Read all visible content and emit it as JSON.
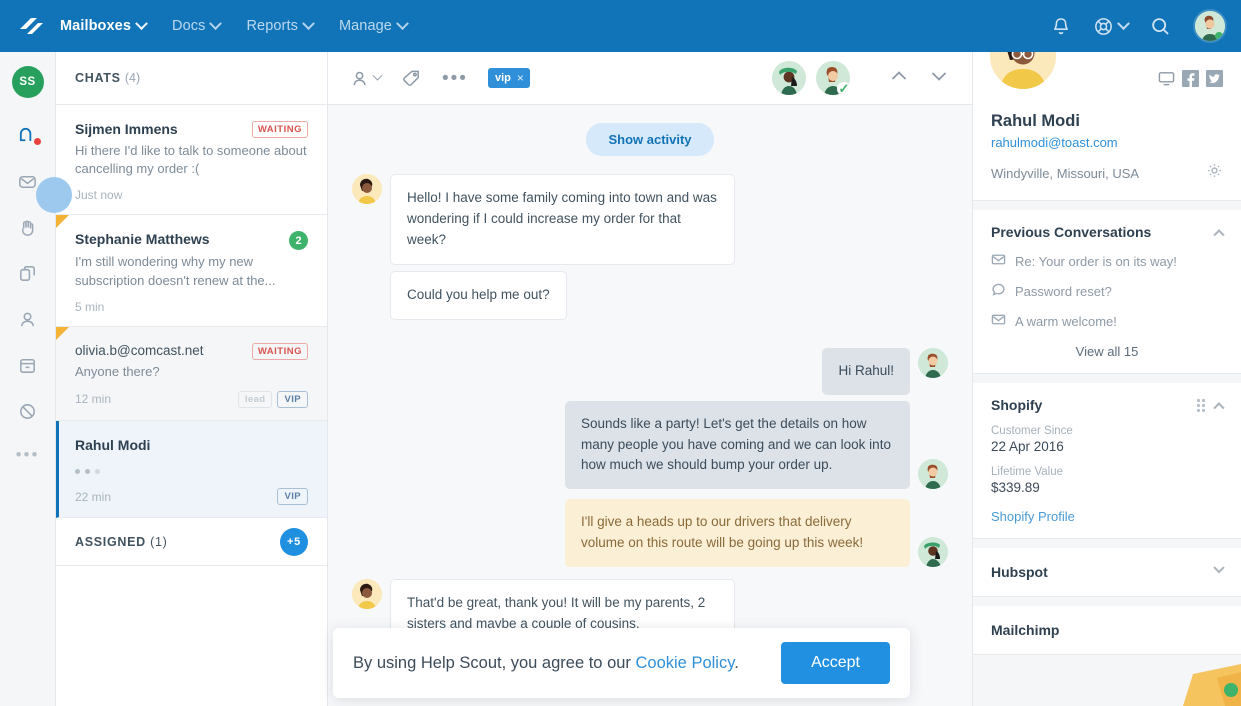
{
  "topnav": {
    "logo": "helpscout-logo-icon",
    "items": [
      {
        "label": "Mailboxes",
        "active": true,
        "caret": true
      },
      {
        "label": "Docs",
        "active": false,
        "caret": true
      },
      {
        "label": "Reports",
        "active": false,
        "caret": true
      },
      {
        "label": "Manage",
        "active": false,
        "caret": true
      }
    ],
    "right": {
      "notifications": "bell-icon",
      "help": "lifebuoy-icon",
      "search": "search-icon",
      "avatar": "user-avatar"
    },
    "brand_color": "#1173b8"
  },
  "rail": {
    "avatar_initials": "SS",
    "avatar_color": "#27a05e",
    "icons": [
      {
        "name": "chats-icon",
        "active": true,
        "badge_color": "#e8433c"
      },
      {
        "name": "unassigned-envelope-icon",
        "active": false
      },
      {
        "name": "mine-hand-icon",
        "active": false
      },
      {
        "name": "drafts-copy-icon",
        "active": false
      },
      {
        "name": "assigned-person-icon",
        "active": false
      },
      {
        "name": "closed-archive-icon",
        "active": false
      },
      {
        "name": "spam-blocked-icon",
        "active": false
      },
      {
        "name": "more-options-icon",
        "active": false
      }
    ],
    "more_glyph": "•••"
  },
  "chatlist": {
    "header": {
      "title": "CHATS",
      "count": "(4)"
    },
    "items": [
      {
        "name": "Sijmen Immens",
        "preview": "Hi there I'd like to talk to someone about cancelling my order :(",
        "time": "Just now",
        "status_badge": "WAITING",
        "unread_count": null,
        "tags": [],
        "state": "unread",
        "corner_flag": false,
        "typing": false
      },
      {
        "name": "Stephanie Matthews",
        "preview": "I'm still wondering why my new subscription doesn't renew at the...",
        "time": "5 min",
        "status_badge": null,
        "unread_count": "2",
        "tags": [],
        "state": "unread",
        "corner_flag": true,
        "typing": false
      },
      {
        "name": "olivia.b@comcast.net",
        "preview": "Anyone there?",
        "time": "12 min",
        "status_badge": "WAITING",
        "unread_count": null,
        "tags": [
          "lead",
          "VIP"
        ],
        "state": "read",
        "corner_flag": true,
        "typing": false
      },
      {
        "name": "Rahul Modi",
        "preview": "",
        "time": "22 min",
        "status_badge": null,
        "unread_count": null,
        "tags": [
          "VIP"
        ],
        "state": "active",
        "corner_flag": false,
        "typing": true
      }
    ],
    "assigned": {
      "title": "ASSIGNED",
      "count": "(1)",
      "overflow_badge": "+5"
    }
  },
  "convo_toolbar": {
    "assign_icon": "assign-person-icon",
    "tag_icon": "tag-icon",
    "more_icon": "more-actions-icon",
    "more_glyph": "•••",
    "tag_chip": {
      "label": "vip",
      "remove": "×"
    },
    "avatars": [
      {
        "name": "agent-avatar-1",
        "checked": false
      },
      {
        "name": "agent-avatar-2",
        "checked": true,
        "check": "✓"
      }
    ],
    "prev_icon": "chevron-up-icon",
    "next_icon": "chevron-down-icon"
  },
  "conversation": {
    "show_activity": "Show activity",
    "messages": [
      {
        "direction": "in",
        "text": "Hello! I have some family coming into town and was wondering if I could increase my order for that week?",
        "avatar": "customer-avatar",
        "kind": "normal"
      },
      {
        "direction": "in",
        "text": "Could you help me out?",
        "avatar": null,
        "kind": "normal"
      },
      {
        "direction": "out",
        "text": "Hi Rahul!",
        "avatar": "agent-avatar-2",
        "kind": "normal"
      },
      {
        "direction": "out",
        "text": "Sounds like a party! Let's get the details on how many people you have coming and we can look into how much we should bump your order up.",
        "avatar": "agent-avatar-2",
        "kind": "normal"
      },
      {
        "direction": "out",
        "text": "I'll give a heads up to our drivers that delivery volume on this route will be going up this week!",
        "avatar": "agent-avatar-1",
        "kind": "note"
      },
      {
        "direction": "in",
        "text": "That'd be great, thank you!  It will be my parents, 2 sisters and maybe a couple of cousins.",
        "avatar": "customer-avatar",
        "kind": "normal"
      }
    ]
  },
  "cookie_banner": {
    "text_before": "By using Help Scout, you agree to our ",
    "link": "Cookie Policy",
    "text_after": ".",
    "accept": "Accept",
    "accept_color": "#2190e0"
  },
  "customer": {
    "name": "Rahul Modi",
    "email": "rahulmodi@toast.com",
    "location": "Windyville, Missouri, USA",
    "avatar": "customer-avatar",
    "socials": [
      "chat-monitor-icon",
      "facebook-icon",
      "twitter-icon"
    ],
    "settings_icon": "gear-icon"
  },
  "previous_conversations": {
    "title": "Previous Conversations",
    "collapse": "chevron-up-icon",
    "items": [
      {
        "icon": "envelope-icon",
        "label": "Re: Your order is on its way!"
      },
      {
        "icon": "chat-bubble-icon",
        "label": "Password reset?"
      },
      {
        "icon": "envelope-icon",
        "label": "A warm welcome!"
      }
    ],
    "view_all": "View all 15"
  },
  "shopify": {
    "title": "Shopify",
    "grip": "drag-handle-icon",
    "collapse": "chevron-up-icon",
    "fields": [
      {
        "label": "Customer Since",
        "value": "22 Apr 2016"
      },
      {
        "label": "Lifetime Value",
        "value": "$339.89"
      }
    ],
    "profile_link": "Shopify Profile"
  },
  "hubspot": {
    "title": "Hubspot",
    "collapse": "chevron-down-icon"
  },
  "mailchimp": {
    "title": "Mailchimp"
  }
}
